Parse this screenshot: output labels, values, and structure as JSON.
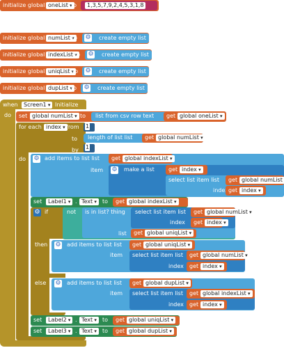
{
  "globals": [
    {
      "kw": "initialize global",
      "name": "oneList",
      "to": "to",
      "value": "1,3,5,7,9,2,4,5,3,1,8"
    },
    {
      "kw": "initialize global",
      "name": "numList",
      "to": "to",
      "value": "create empty list"
    },
    {
      "kw": "initialize global",
      "name": "indexList",
      "to": "to",
      "value": "create empty list"
    },
    {
      "kw": "initialize global",
      "name": "uniqList",
      "to": "to",
      "value": "create empty list"
    },
    {
      "kw": "initialize global",
      "name": "dupList",
      "to": "to",
      "value": "create empty list"
    }
  ],
  "event": {
    "when": "when",
    "component": "Screen1",
    "event": "Initialize",
    "do": "do"
  },
  "set_numlist": {
    "set": "set",
    "var": "global numList",
    "to": "to",
    "csv": "list from csv row  text",
    "get": "get",
    "arg": "global oneList"
  },
  "foreach": {
    "label": "for each",
    "var": "index",
    "from": "from",
    "from_val": "1",
    "to": "to",
    "len": "length of list  list",
    "get": "get",
    "len_arg": "global numList",
    "by": "by",
    "by_val": "1",
    "do": "do"
  },
  "add_index": {
    "label": "add items to list  list",
    "get": "get",
    "list": "global indexList",
    "item": "item",
    "make": "make a list",
    "get2": "get",
    "idx": "index",
    "select": "select list item  list",
    "get3": "get",
    "numlist": "global numList",
    "index": "index",
    "get4": "get",
    "idx2": "index"
  },
  "set_label1": {
    "set": "set",
    "comp": "Label1",
    "prop": "Text",
    "to": "to",
    "get": "get",
    "arg": "global indexList"
  },
  "if_block": {
    "if": "if",
    "not": "not",
    "isin": "is in list? thing",
    "select": "select list item  list",
    "get": "get",
    "numlist": "global numList",
    "index": "index",
    "get2": "get",
    "idx": "index",
    "list": "list",
    "get3": "get",
    "uniq": "global uniqList",
    "then": "then",
    "else": "else"
  },
  "then_add": {
    "label": "add items to list  list",
    "get": "get",
    "list": "global uniqList",
    "item": "item",
    "select": "select list item  list",
    "get2": "get",
    "numlist": "global numList",
    "index": "index",
    "get3": "get",
    "idx": "index"
  },
  "else_add": {
    "label": "add items to list  list",
    "get": "get",
    "list": "global dupList",
    "item": "item",
    "select": "select list item  list",
    "get2": "get",
    "indexlist": "global indexList",
    "index": "index",
    "get3": "get",
    "idx": "index"
  },
  "set_label2": {
    "set": "set",
    "comp": "Label2",
    "prop": "Text",
    "to": "to",
    "get": "get",
    "arg": "global uniqList"
  },
  "set_label3": {
    "set": "set",
    "comp": "Label3",
    "prop": "Text",
    "to": "to",
    "get": "get",
    "arg": "global dupList"
  },
  "colors": {
    "variable": "#d9632b",
    "list": "#4ea7db",
    "control": "#b5942a",
    "component": "#2c8a51",
    "logic": "#3dae9c",
    "math": "#2a5f8f"
  }
}
